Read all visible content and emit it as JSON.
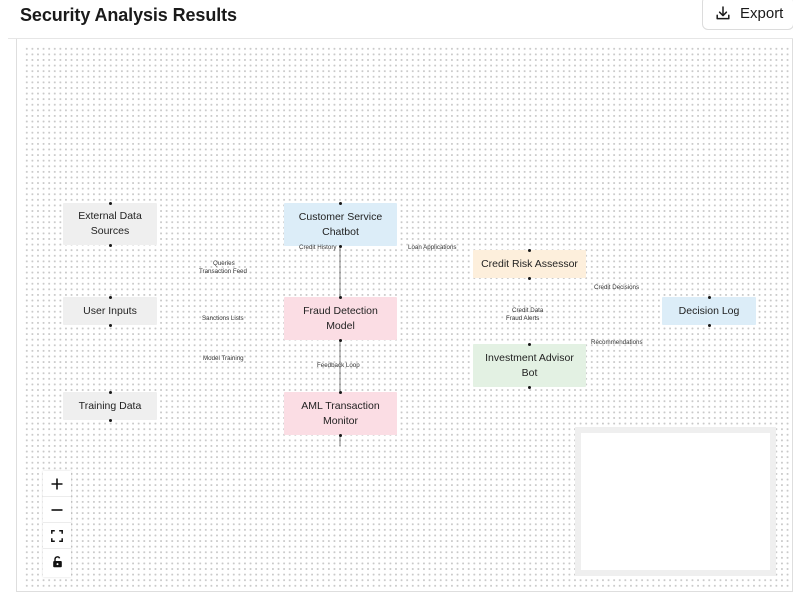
{
  "header": {
    "title": "Security Analysis Results",
    "export_label": "Export"
  },
  "diagram": {
    "nodes": {
      "external_data_sources": "External Data Sources",
      "user_inputs": "User Inputs",
      "training_data": "Training Data",
      "customer_service_chatbot": "Customer Service Chatbot",
      "fraud_detection_model": "Fraud Detection Model",
      "aml_transaction_monitor": "AML Transaction Monitor",
      "credit_risk_assessor": "Credit Risk Assessor",
      "investment_advisor_bot": "Investment Advisor Bot",
      "decision_log": "Decision Log"
    },
    "edge_labels": {
      "queries": "Queries",
      "transaction_feed": "Transaction Feed",
      "sanctions_lists": "Sanctions Lists",
      "model_training": "Model Training",
      "credit_history": "Credit History",
      "feedback_loop": "Feedback Loop",
      "loan_applications": "Loan Applications",
      "credit_data": "Credit Data",
      "fraud_alerts": "Fraud Alerts",
      "credit_decisions": "Credit Decisions",
      "recommendations": "Recommendations"
    }
  },
  "controls": {
    "zoom_in_icon": "plus-icon",
    "zoom_out_icon": "minus-icon",
    "fit_view_icon": "fit-view-icon",
    "lock_icon": "unlock-icon"
  }
}
